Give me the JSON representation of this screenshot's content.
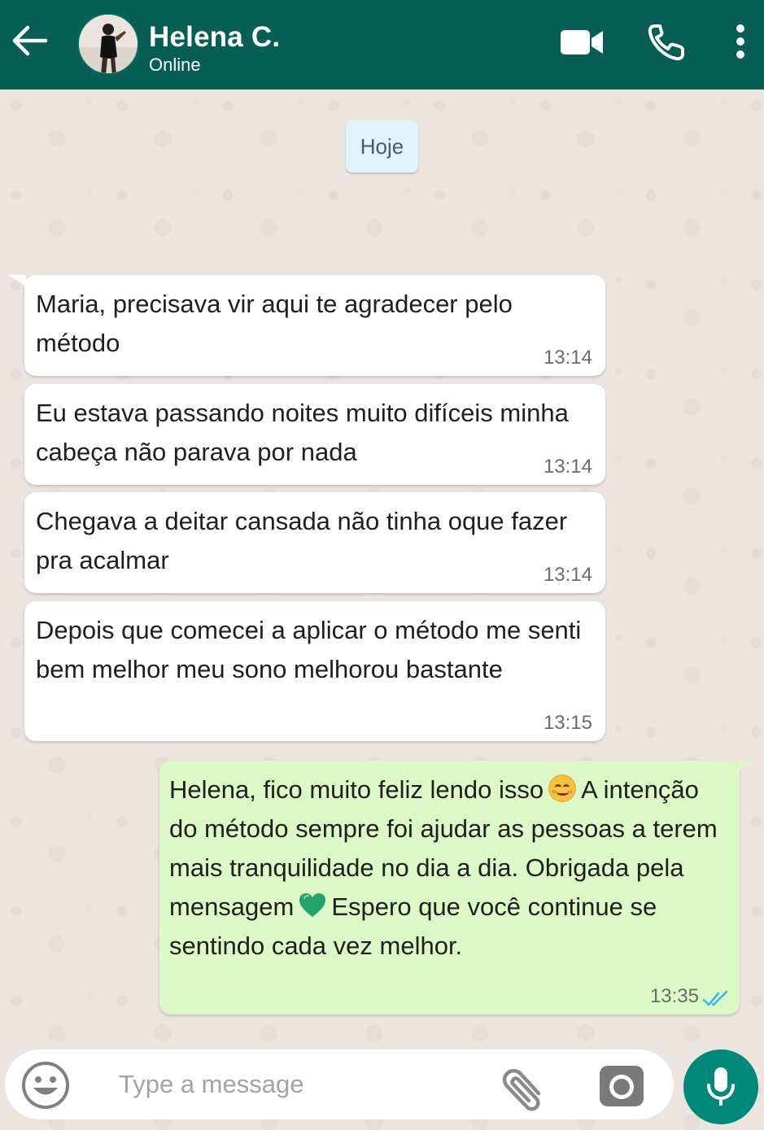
{
  "header": {
    "contact_name": "Helena C.",
    "status": "Online",
    "back_icon": "arrow-left-icon",
    "video_icon": "video-camera-icon",
    "call_icon": "phone-icon",
    "menu_icon": "more-vertical-icon",
    "background_color": "#075e54"
  },
  "chat": {
    "date_label": "Hoje",
    "messages": [
      {
        "direction": "in",
        "text": "Maria, precisava vir aqui te agradecer pelo método",
        "time": "13:14"
      },
      {
        "direction": "in",
        "text": "Eu estava passando noites muito difíceis minha cabeça não parava por nada",
        "time": "13:14"
      },
      {
        "direction": "in",
        "text": "Chegava a deitar cansada não tinha oque fazer pra acalmar",
        "time": "13:14"
      },
      {
        "direction": "in",
        "text": "Depois que comecei a aplicar o método me senti bem melhor meu sono melhorou bastante",
        "time": "13:15"
      },
      {
        "direction": "out",
        "text_part1": "Helena, fico muito feliz lendo isso",
        "emoji1": "smiling-face-emoji",
        "text_part2": "A intenção do método sempre foi ajudar as pessoas a terem mais tranquilidade no dia a dia. Obrigada pela mensagem",
        "emoji2": "green-heart-emoji",
        "text_part3": "Espero que você continue se sentindo cada vez melhor.",
        "time": "13:35",
        "status": "read"
      }
    ],
    "incoming_bubble_color": "#ffffff",
    "outgoing_bubble_color": "#dcf8c6",
    "read_tick_color": "#34b7f1"
  },
  "composer": {
    "placeholder": "Type a message",
    "value": "",
    "emoji_icon": "smiley-icon",
    "attach_icon": "paperclip-icon",
    "camera_icon": "camera-icon",
    "mic_icon": "microphone-icon",
    "accent_color": "#00897b"
  }
}
